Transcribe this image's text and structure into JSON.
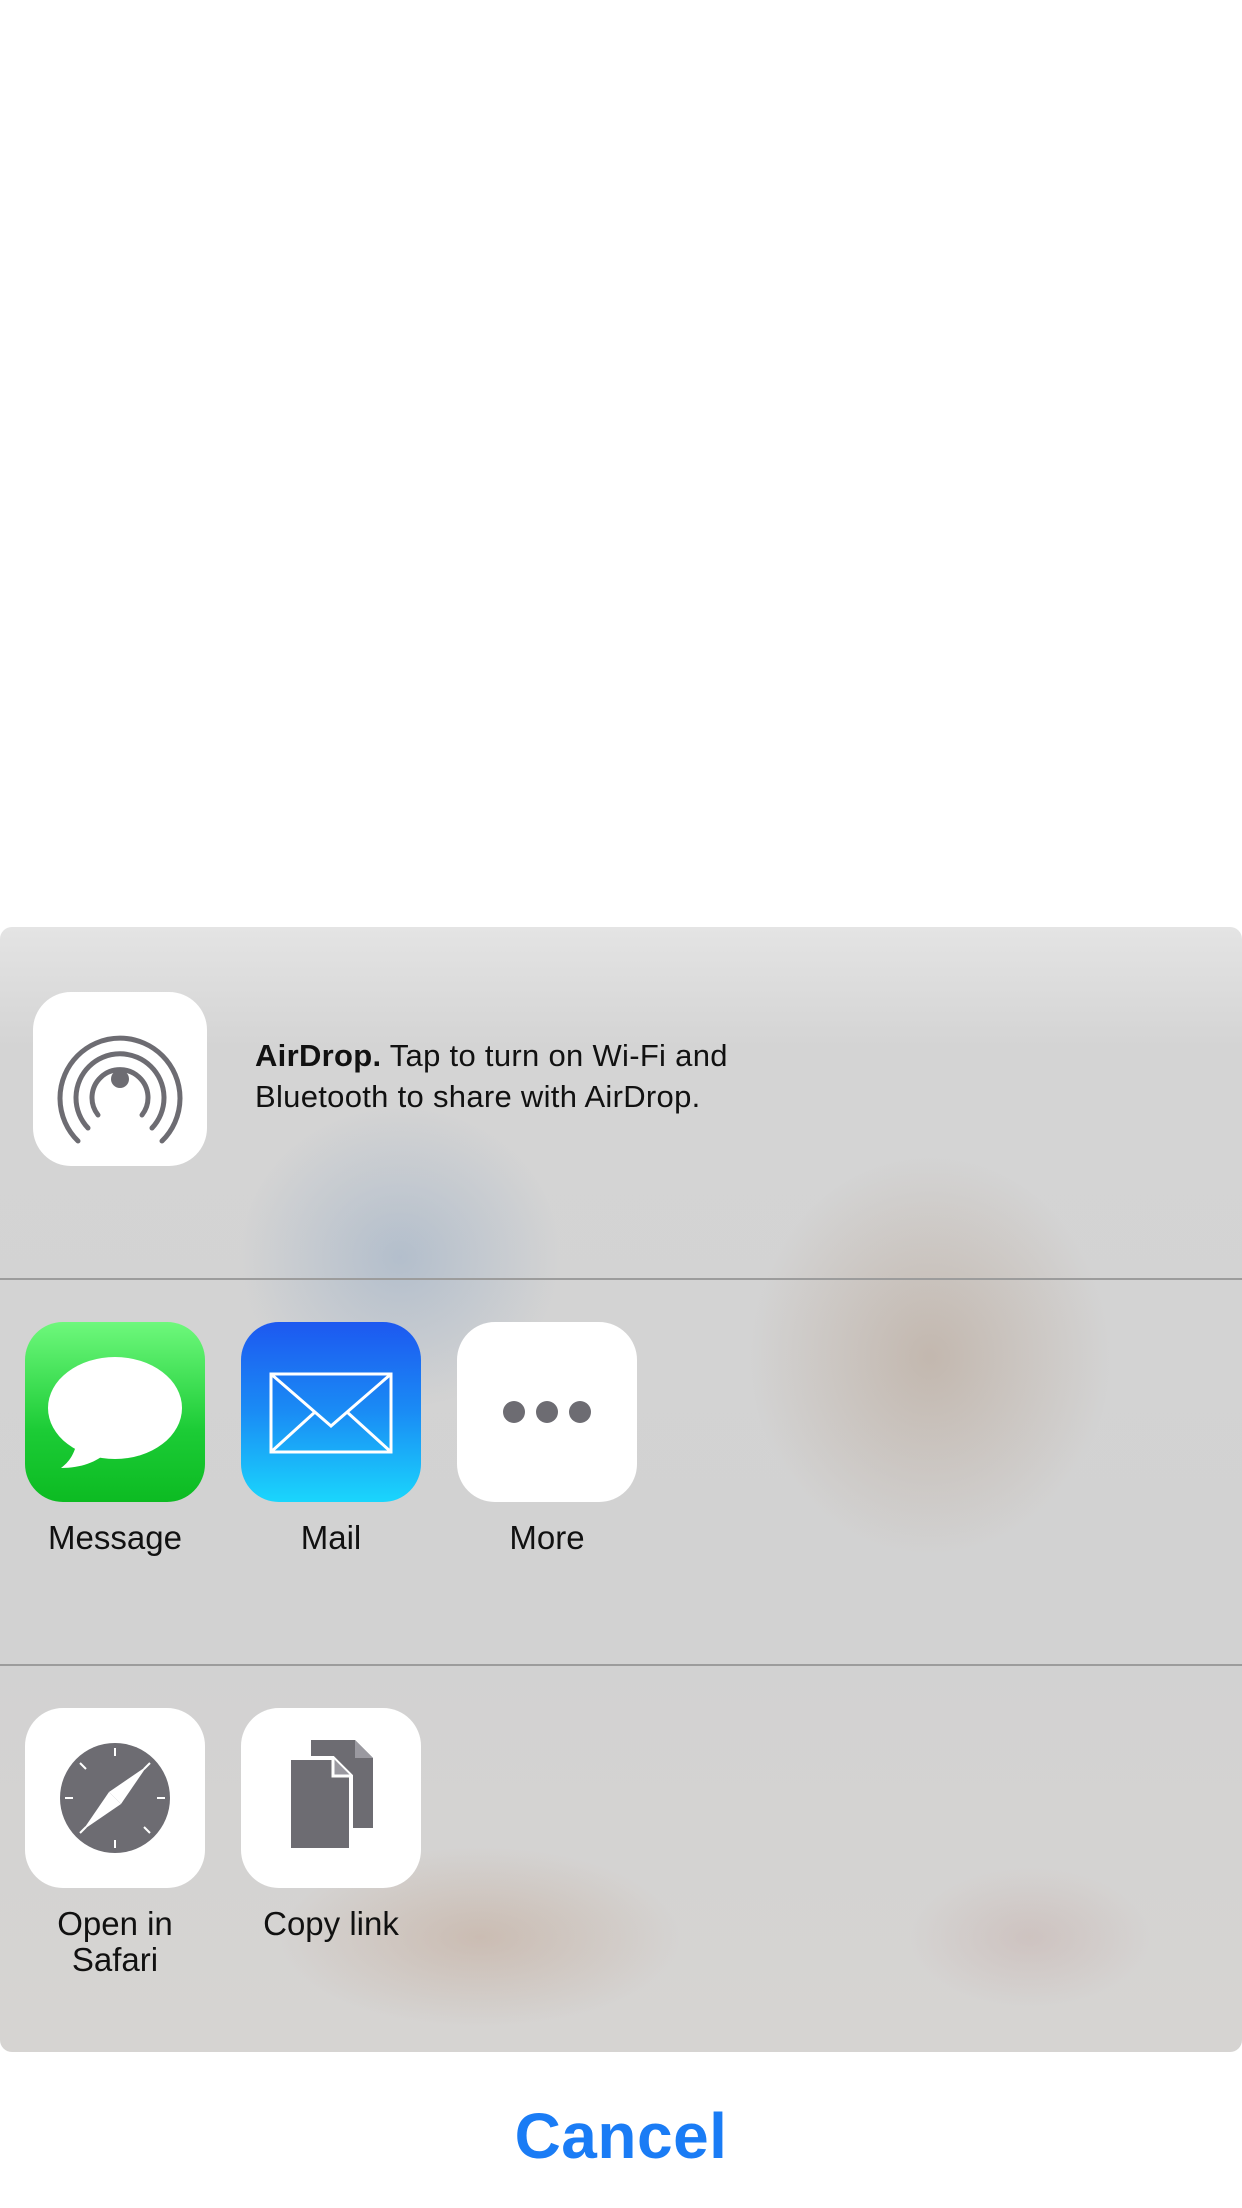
{
  "airdrop": {
    "icon": "airdrop-icon",
    "title": "AirDrop.",
    "message": " Tap to turn on Wi-Fi and Bluetooth to share with AirDrop."
  },
  "share_apps": [
    {
      "label": "Message",
      "icon": "message-icon",
      "color": "#16c224"
    },
    {
      "label": "Mail",
      "icon": "mail-icon",
      "color": "#1a8cf5"
    },
    {
      "label": "More",
      "icon": "more-icon",
      "color": "#ffffff"
    }
  ],
  "actions": [
    {
      "label": "Open in\nSafari",
      "icon": "safari-compass-icon"
    },
    {
      "label": "Copy link",
      "icon": "copy-document-icon"
    }
  ],
  "cancel_label": "Cancel",
  "colors": {
    "accent": "#1a7cf5",
    "sheet_bg": "#d3d3d3",
    "glyph_gray": "#6d6c72"
  }
}
